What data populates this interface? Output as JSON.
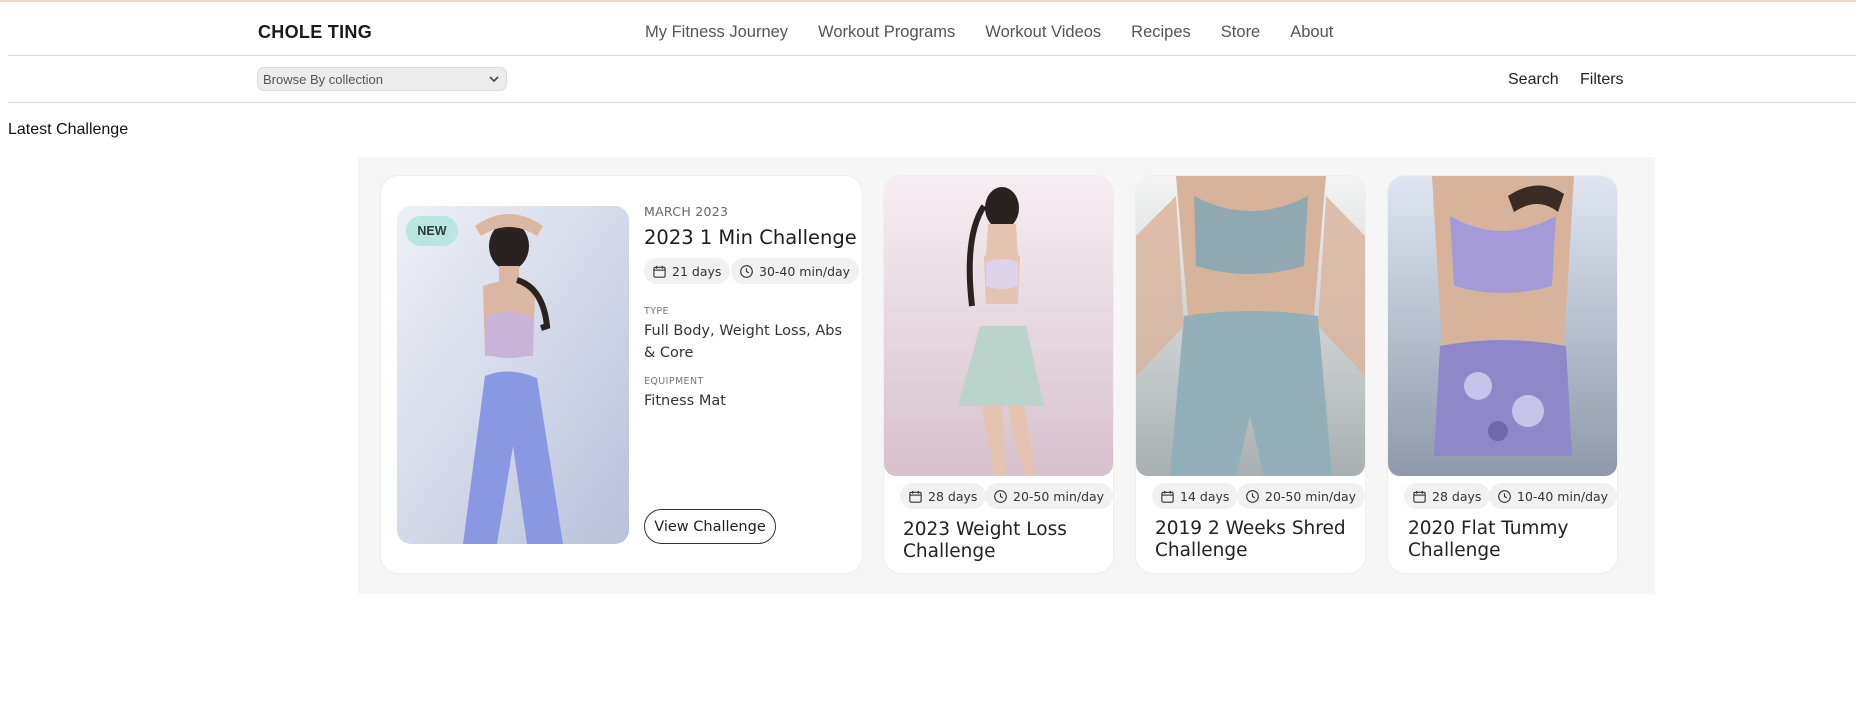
{
  "brand": "CHOLE TING",
  "nav": [
    "My Fitness Journey",
    "Workout Programs",
    "Workout Videos",
    "Recipes",
    "Store",
    "About"
  ],
  "collection_select": "Browse By collection",
  "toolbar": {
    "search": "Search",
    "filters": "Filters"
  },
  "section_title": "Latest Challenge",
  "featured": {
    "badge": "NEW",
    "date": "MARCH 2023",
    "title": "2023 1 Min Challenge",
    "days": "21 days",
    "duration": "30-40 min/day",
    "type_label": "TYPE",
    "type_value": "Full Body, Weight Loss, Abs & Core",
    "equipment_label": "EQUIPMENT",
    "equipment_value": "Fitness Mat",
    "cta": "View Challenge"
  },
  "cards": [
    {
      "days": "28 days",
      "duration": "20-50 min/day",
      "title": "2023 Weight Loss Challenge"
    },
    {
      "days": "14 days",
      "duration": "20-50 min/day",
      "title": "2019 2 Weeks Shred Challenge"
    },
    {
      "days": "28 days",
      "duration": "10-40 min/day",
      "title": "2020 Flat Tummy Challenge"
    }
  ],
  "icons": {
    "calendar": "calendar-icon",
    "clock": "clock-icon",
    "chevron": "chevron-down-icon"
  },
  "colors": {
    "badge": "#b9e6e0",
    "panel": "#f6f6f6",
    "top_rule": "#e8d6cf"
  }
}
